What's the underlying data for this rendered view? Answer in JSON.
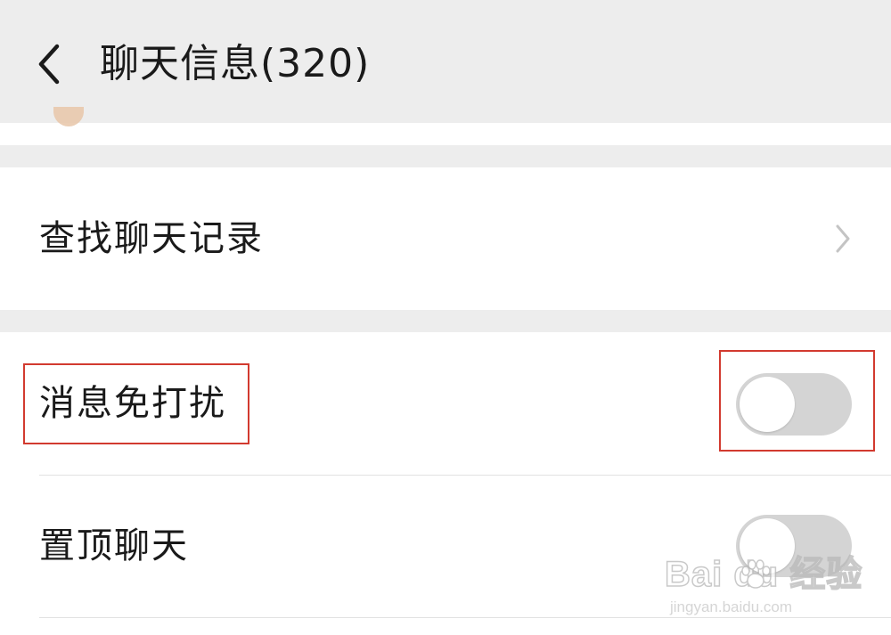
{
  "header": {
    "back_icon": "chevron-left-icon",
    "title": "聊天信息(320)"
  },
  "search_card": {
    "label": "查找聊天记录",
    "chevron_icon": "chevron-right-icon"
  },
  "settings": {
    "mute": {
      "label": "消息免打扰",
      "enabled": false
    },
    "pin": {
      "label": "置顶聊天",
      "enabled": false
    }
  },
  "watermark": {
    "brand": "Bai  du 经验",
    "url": "jingyan.baidu.com"
  },
  "colors": {
    "background": "#ededed",
    "card": "#ffffff",
    "toggle_off": "#d4d4d4",
    "highlight": "#d23a2f"
  }
}
